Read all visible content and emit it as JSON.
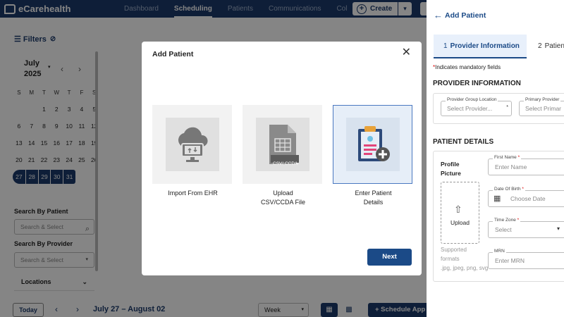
{
  "app": {
    "name": "eCarehealth"
  },
  "nav": {
    "items": [
      "Dashboard",
      "Scheduling",
      "Patients",
      "Communications",
      "Col"
    ],
    "active": "Scheduling",
    "more": "›"
  },
  "header": {
    "create_label": "Create",
    "create_plus": "+",
    "create_caret": "▾"
  },
  "filters": {
    "label": "Filters",
    "filter_icon": "☰",
    "eye_off_icon": "⊘"
  },
  "calendar": {
    "month": "July",
    "year": "2025",
    "caret": "▾",
    "prev": "‹",
    "next": "›",
    "weekday_headers": [
      "S",
      "M",
      "T",
      "W",
      "T",
      "F",
      "S"
    ],
    "weeks": [
      [
        "",
        "",
        "1",
        "2",
        "3",
        "4",
        "5"
      ],
      [
        "6",
        "7",
        "8",
        "9",
        "10",
        "11",
        "12"
      ],
      [
        "13",
        "14",
        "15",
        "16",
        "17",
        "18",
        "19"
      ],
      [
        "20",
        "21",
        "22",
        "23",
        "24",
        "25",
        "26"
      ],
      [
        "27",
        "28",
        "29",
        "30",
        "31",
        "",
        ""
      ]
    ],
    "selected_days": [
      "27",
      "28",
      "29",
      "30",
      "31"
    ]
  },
  "sidebar": {
    "search_patient_label": "Search By Patient",
    "search_patient_placeholder": "Search & Select",
    "search_provider_label": "Search By Provider",
    "search_provider_placeholder": "Search & Select",
    "locations_label": "Locations",
    "search_icon": "⌕",
    "caret": "▾",
    "chevron": "⌄"
  },
  "bottom_bar": {
    "today_label": "Today",
    "prev": "‹",
    "next": "›",
    "date_range": "July 27 – August 02",
    "view_select": "Week",
    "caret": "▾",
    "list_icon": "▦",
    "calendar_icon": "▩",
    "schedule_label": "+ Schedule App"
  },
  "modal": {
    "title": "Add Patient",
    "close_icon": "✕",
    "options": [
      {
        "label": "Import From EHR",
        "icon": "cloud-monitor-icon",
        "selected": false
      },
      {
        "label": "Upload CSV/CCDA File",
        "line1": "Upload",
        "line2": "CSV/CCDA File",
        "icon": "file-upload-icon",
        "badge": "CSV/ CCDA",
        "selected": false
      },
      {
        "label": "Enter Patient Details",
        "line1": "Enter Patient",
        "line2": "Details",
        "icon": "clipboard-plus-icon",
        "selected": true
      }
    ],
    "next_label": "Next"
  },
  "panel": {
    "back_label": "Add Patient",
    "back_icon": "←",
    "steps": [
      {
        "number": "1",
        "label": "Provider Information",
        "active": true
      },
      {
        "number": "2",
        "label": "Patient",
        "active": false
      }
    ],
    "mandatory_note": "Indicates mandatory fields",
    "mandatory_star": "*",
    "provider_section_title": "PROVIDER INFORMATION",
    "provider_group_label": "Provider Group Location",
    "provider_group_placeholder": "Select Provider...",
    "primary_provider_label": "Primary Provider",
    "primary_provider_placeholder": "Select Primar",
    "patient_section_title": "PATIENT DETAILS",
    "profile_picture_label_1": "Profile",
    "profile_picture_label_2": "Picture",
    "upload_icon": "⇧",
    "upload_label": "Upload",
    "supported_1": "Supported",
    "supported_2": "formats",
    "supported_3": ".jpg, jpeg, png, svg",
    "first_name_label": "First Name",
    "first_name_placeholder": "Enter Name",
    "dob_label": "Date Of Birth",
    "dob_placeholder": "Choose Date",
    "dob_icon": "▦",
    "timezone_label": "Time Zone",
    "timezone_placeholder": "Select",
    "mrn_label": "MRN",
    "mrn_placeholder": "Enter MRN",
    "star": "*"
  }
}
